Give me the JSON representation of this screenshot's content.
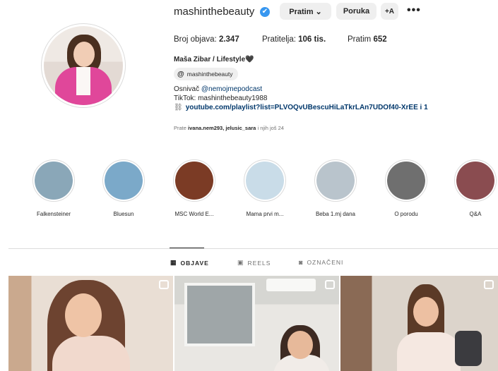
{
  "profile": {
    "username": "mashinthebeauty",
    "verified_glyph": "✔",
    "buttons": {
      "follow": "Pratim ⌄",
      "message": "Poruka",
      "add_user": "+A",
      "more": "•••"
    },
    "stats": {
      "posts_label": "Broj objava:",
      "posts_value": "2.347",
      "followers_label": "Pratitelja:",
      "followers_value": "106 tis.",
      "following_label": "Pratim",
      "following_value": "652"
    },
    "full_name": "Maša Zibar / Lifestyle🖤",
    "threads_handle": "mashinthebeauty",
    "bio": {
      "founder_prefix": "Osnivač",
      "founder_link": "@nemojmepodcast",
      "tiktok": "TikTok: mashinthebeauty1988",
      "link": "youtube.com/playlist?list=PLVOQvUBescuHiLaTkrLAn7UDOf40-XrEE i 1"
    },
    "followed_by": {
      "prefix": "Prate",
      "names": "ivana.nem293, jelusic_sara",
      "suffix": "i njih još 24"
    }
  },
  "highlights": [
    {
      "label": "Falkensteiner",
      "color": "#8aa7b8"
    },
    {
      "label": "Bluesun",
      "color": "#7ba9c9"
    },
    {
      "label": "MSC World E...",
      "color": "#7b3b25"
    },
    {
      "label": "Mama prvi m...",
      "color": "#c9dce8"
    },
    {
      "label": "Beba 1.mj dana",
      "color": "#b9c4cc"
    },
    {
      "label": "O porodu",
      "color": "#6f6f6f"
    },
    {
      "label": "Q&A",
      "color": "#8a4c50"
    }
  ],
  "tabs": {
    "posts": "OBJAVE",
    "reels": "REELS",
    "tagged": "OZNAČENI"
  },
  "icons": {
    "verified": "verified-badge-icon",
    "threads": "threads-icon",
    "link": "link-chain-icon",
    "grid": "grid-icon",
    "reels": "reels-icon",
    "tagged": "tagged-icon"
  }
}
